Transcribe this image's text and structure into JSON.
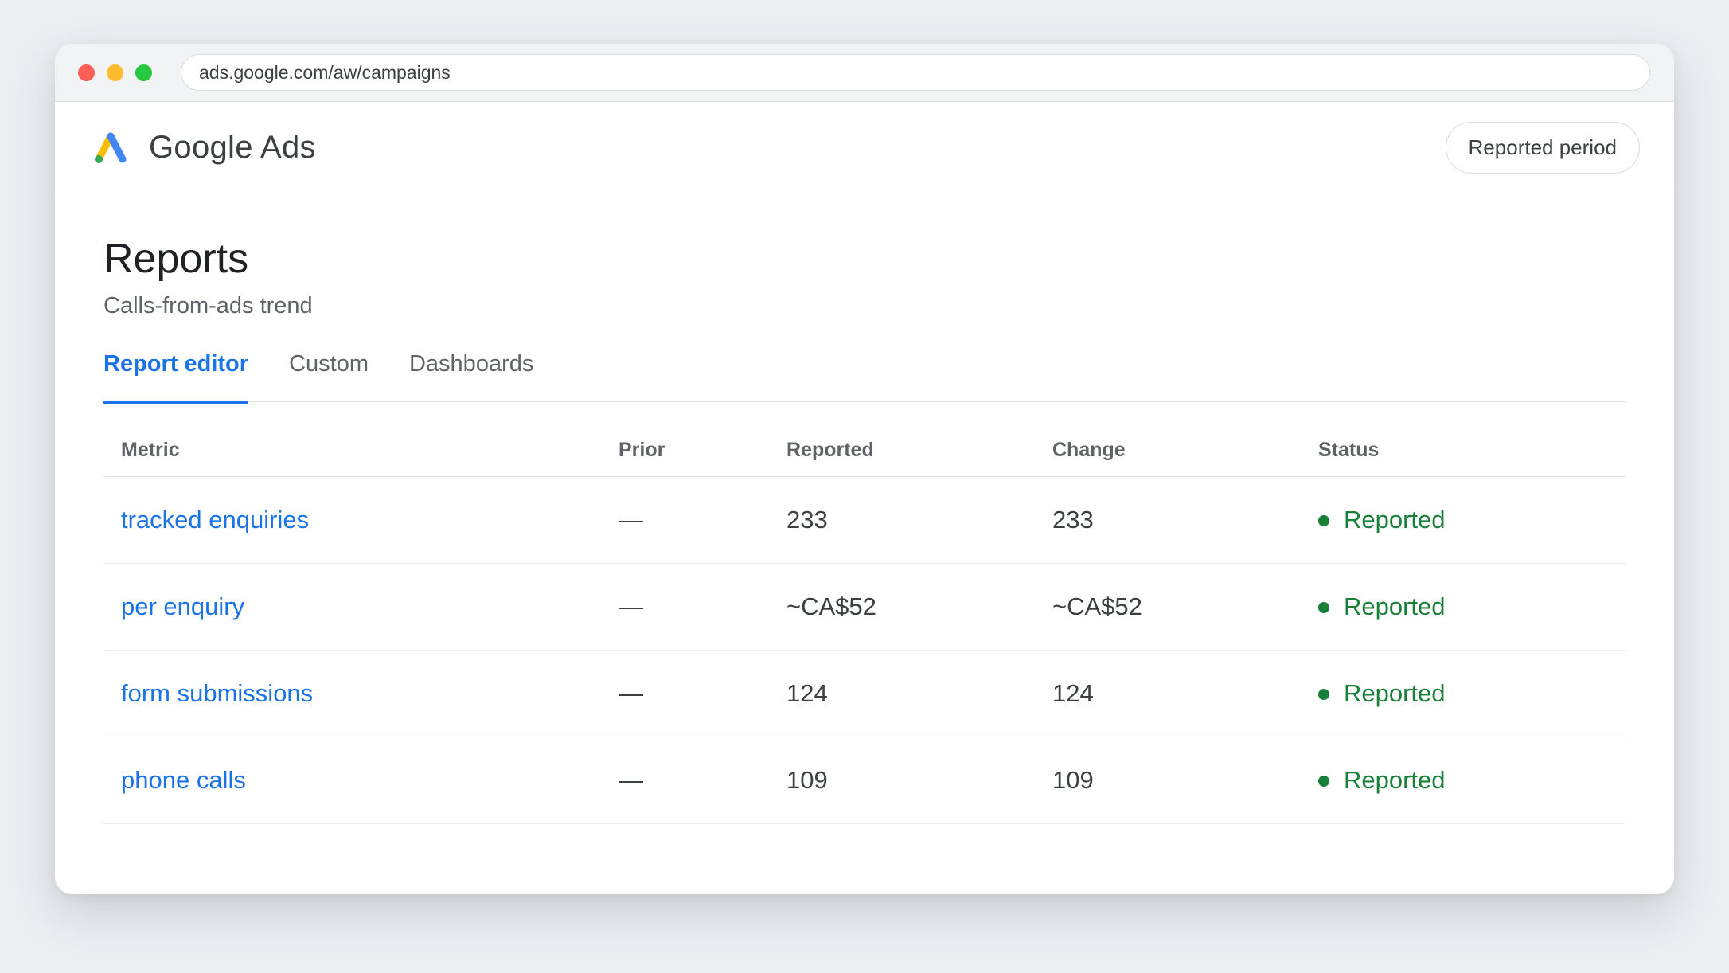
{
  "browser": {
    "url": "ads.google.com/aw/campaigns"
  },
  "header": {
    "app_name": "Google Ads",
    "logo_icon": "google-ads-logo",
    "period_button": "Reported period"
  },
  "page": {
    "title": "Reports",
    "subtitle": "Calls-from-ads trend"
  },
  "tabs": [
    {
      "label": "Report editor",
      "active": true
    },
    {
      "label": "Custom",
      "active": false
    },
    {
      "label": "Dashboards",
      "active": false
    }
  ],
  "table": {
    "columns": [
      "Metric",
      "Prior",
      "Reported",
      "Change",
      "Status"
    ],
    "rows": [
      {
        "metric": "tracked enquiries",
        "prior": "—",
        "reported": "233",
        "change": "233",
        "status": "Reported"
      },
      {
        "metric": "per enquiry",
        "prior": "—",
        "reported": "~CA$52",
        "change": "~CA$52",
        "status": "Reported"
      },
      {
        "metric": "form submissions",
        "prior": "—",
        "reported": "124",
        "change": "124",
        "status": "Reported"
      },
      {
        "metric": "phone calls",
        "prior": "—",
        "reported": "109",
        "change": "109",
        "status": "Reported"
      }
    ]
  },
  "colors": {
    "accent": "#1a73e8",
    "status_ok": "#188038"
  }
}
